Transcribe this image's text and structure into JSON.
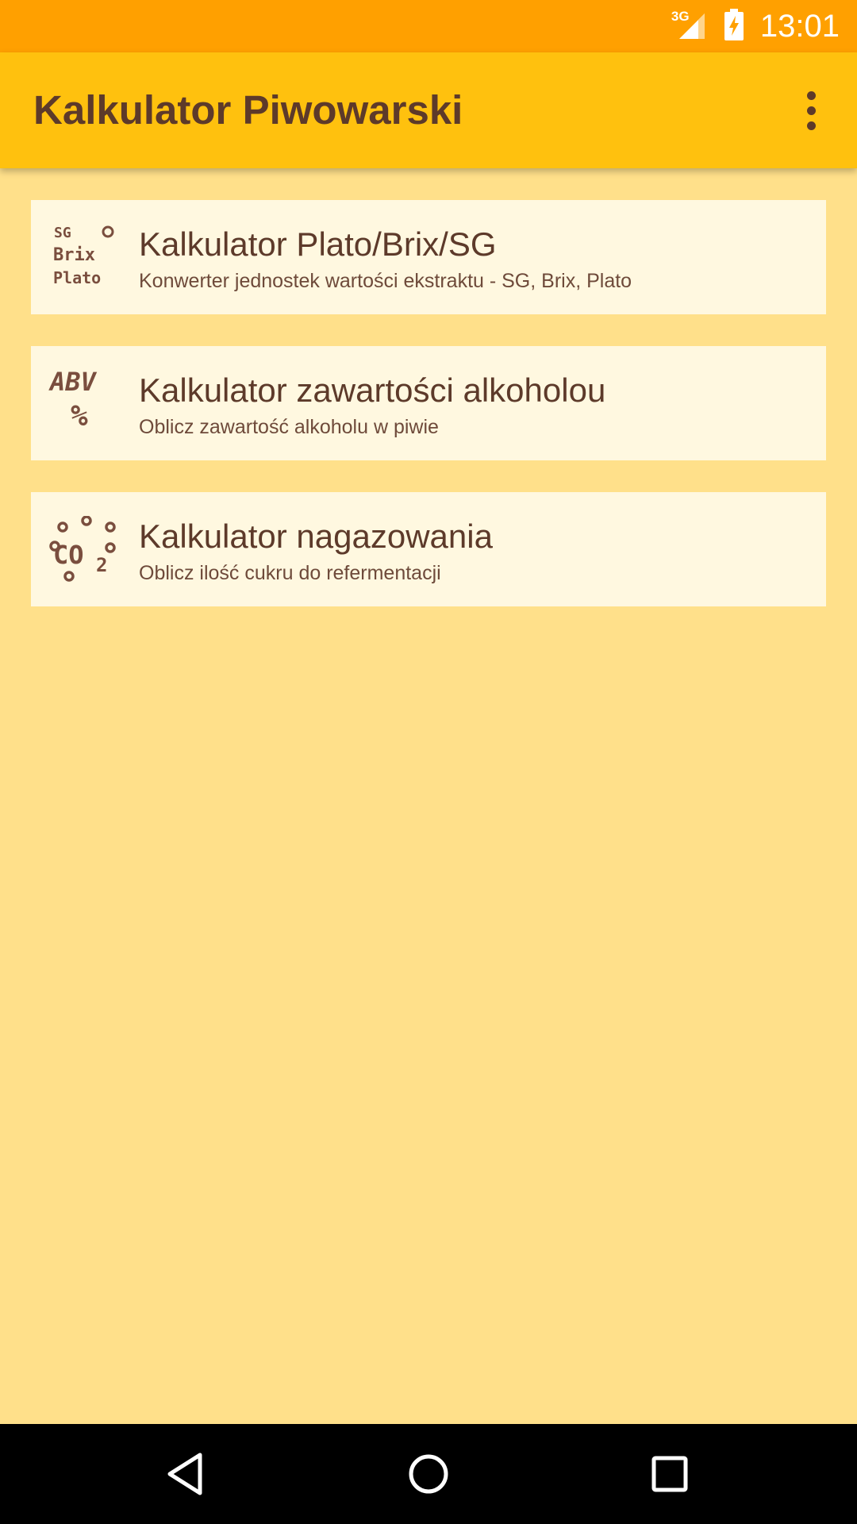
{
  "status_bar": {
    "network": "3G",
    "time": "13:01",
    "icons": [
      "signal-3g-icon",
      "battery-charging-icon"
    ]
  },
  "app_bar": {
    "title": "Kalkulator Piwowarski",
    "menu_icon": "overflow-menu-icon"
  },
  "calculators": [
    {
      "icon": "sg-brix-plato-icon",
      "title": "Kalkulator Plato/Brix/SG",
      "subtitle": "Konwerter jednostek wartości ekstraktu - SG, Brix, Plato"
    },
    {
      "icon": "abv-percent-icon",
      "title": "Kalkulator zawartości alkoholou",
      "subtitle": "Oblicz zawartość alkoholu w piwie"
    },
    {
      "icon": "co2-bubbles-icon",
      "title": "Kalkulator nagazowania",
      "subtitle": "Oblicz ilość cukru do refermentacji"
    }
  ],
  "icon_texts": {
    "sg": "SG",
    "brix": "Brix",
    "plato": "Plato",
    "abv": "ABV",
    "percent": "%",
    "co2": "CO",
    "co2_sub": "2"
  },
  "navigation": [
    "back-icon",
    "home-icon",
    "recent-apps-icon"
  ],
  "colors": {
    "status_bar": "#FFA000",
    "app_bar": "#FFC10E",
    "background": "#FFE08A",
    "card": "#FFF8E0",
    "text": "#5D3A2A"
  }
}
